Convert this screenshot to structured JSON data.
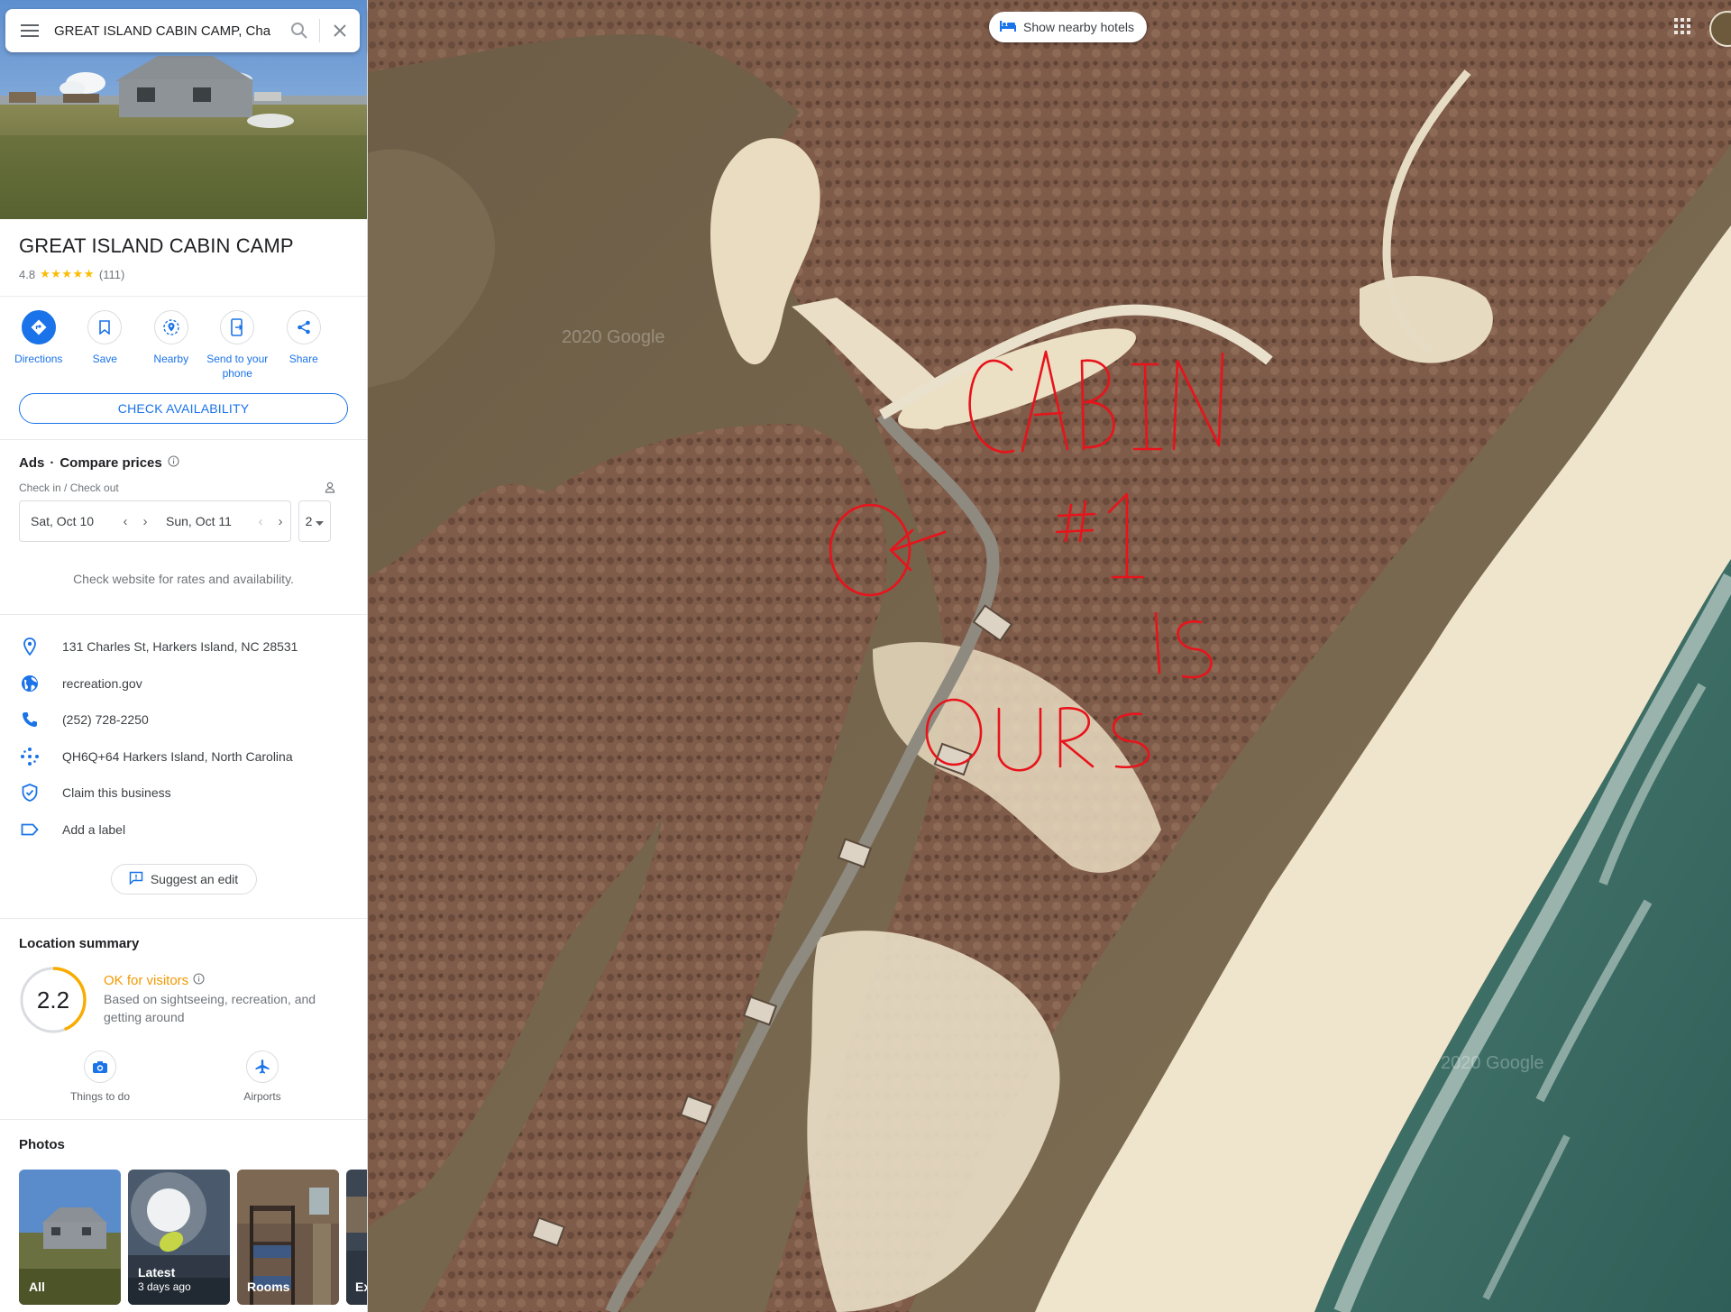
{
  "search": {
    "query": "GREAT ISLAND CABIN CAMP, Cha"
  },
  "place": {
    "title": "GREAT ISLAND CABIN CAMP",
    "rating": "4.8",
    "stars": "★★★★★",
    "review_count": "(111)"
  },
  "actions": [
    {
      "label": "Directions",
      "icon": "directions-icon"
    },
    {
      "label": "Save",
      "icon": "bookmark-icon"
    },
    {
      "label": "Nearby",
      "icon": "nearby-icon"
    },
    {
      "label": "Send to your phone",
      "icon": "send-to-phone-icon"
    },
    {
      "label": "Share",
      "icon": "share-icon"
    }
  ],
  "check_availability": "CHECK AVAILABILITY",
  "prices": {
    "ads": "Ads",
    "dot": "·",
    "heading": "Compare prices",
    "checkin_label": "Check in / Check out",
    "checkin": "Sat, Oct 10",
    "checkout": "Sun, Oct 11",
    "guests": "2",
    "note": "Check website for rates and availability."
  },
  "info": [
    {
      "text": "131 Charles St, Harkers Island, NC 28531",
      "icon": "location-pin-icon"
    },
    {
      "text": "recreation.gov",
      "icon": "globe-icon"
    },
    {
      "text": "(252) 728-2250",
      "icon": "phone-icon"
    },
    {
      "text": "QH6Q+64 Harkers Island, North Carolina",
      "icon": "plus-code-icon"
    },
    {
      "text": "Claim this business",
      "icon": "shield-check-icon"
    },
    {
      "text": "Add a label",
      "icon": "label-icon"
    }
  ],
  "suggest_edit": "Suggest an edit",
  "location_summary": {
    "title": "Location summary",
    "score": "2.2",
    "score_fraction": 0.44,
    "label": "OK for visitors",
    "description": "Based on sightseeing, recreation, and getting around",
    "nearby": [
      {
        "label": "Things to do",
        "icon": "camera-icon"
      },
      {
        "label": "Airports",
        "icon": "airplane-icon"
      }
    ]
  },
  "photos": {
    "title": "Photos",
    "items": [
      {
        "label": "All",
        "sub": ""
      },
      {
        "label": "Latest",
        "sub": "3 days ago"
      },
      {
        "label": "Rooms",
        "sub": ""
      },
      {
        "label": "Ex",
        "sub": ""
      }
    ]
  },
  "map": {
    "hotels_chip": "Show nearby hotels",
    "annotation": {
      "line1": "CABIN",
      "line2": "#1",
      "line3": "IS",
      "line4": "OURS",
      "color": "#e8131b"
    },
    "watermark": "2020 Google"
  },
  "colors": {
    "accent": "#1a73e8",
    "ok": "#f29900",
    "ocean": "#3e6f64",
    "sand": "#efe3c8",
    "marsh": "#7c5a48"
  }
}
